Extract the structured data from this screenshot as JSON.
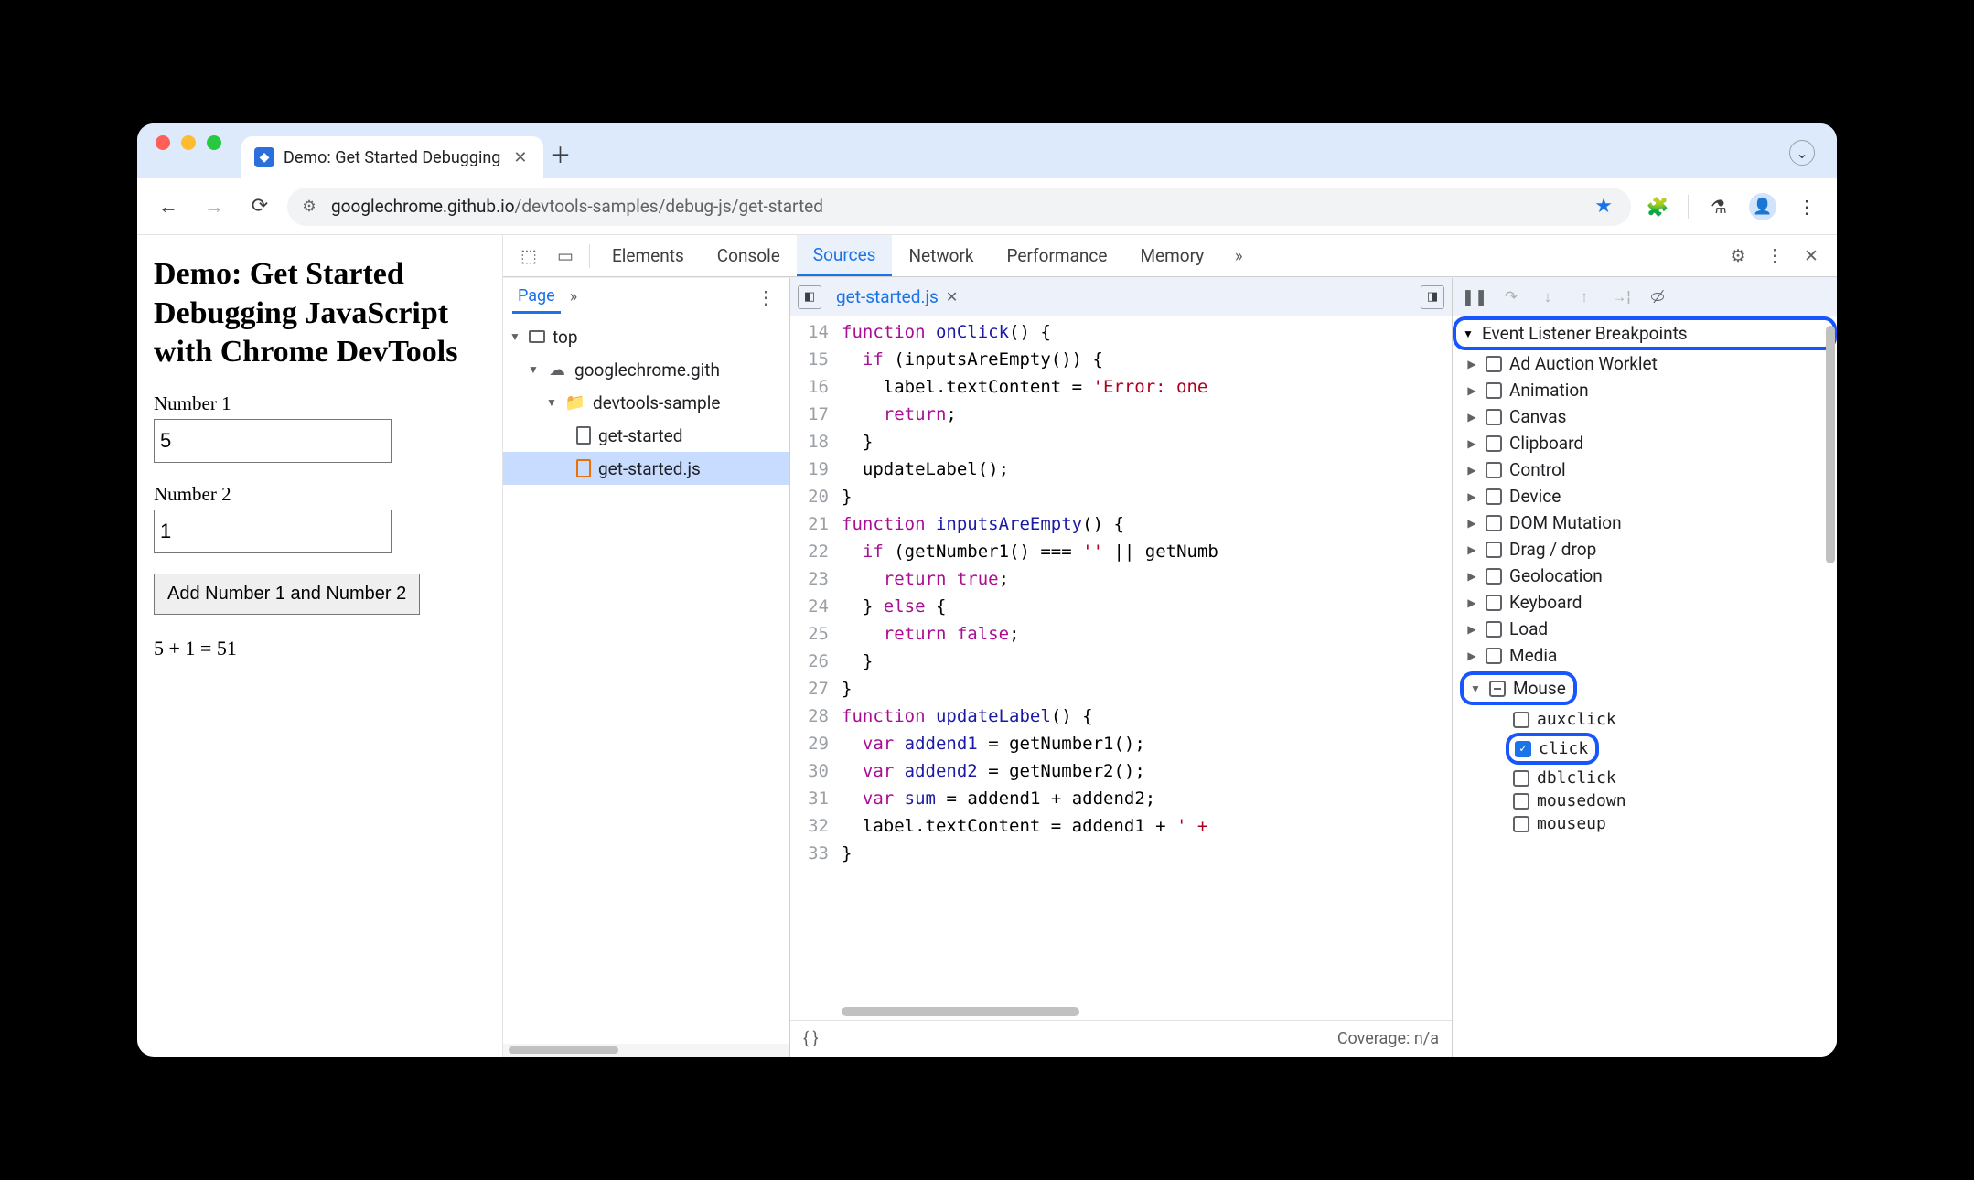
{
  "tab": {
    "title": "Demo: Get Started Debugging"
  },
  "url": {
    "host": "googlechrome.github.io",
    "path": "/devtools-samples/debug-js/get-started"
  },
  "page": {
    "heading": "Demo: Get Started Debugging JavaScript with Chrome DevTools",
    "label1": "Number 1",
    "value1": "5",
    "label2": "Number 2",
    "value2": "1",
    "button": "Add Number 1 and Number 2",
    "result": "5 + 1 = 51"
  },
  "devtools": {
    "tabs": [
      "Elements",
      "Console",
      "Sources",
      "Network",
      "Performance",
      "Memory"
    ],
    "active_tab": "Sources",
    "nav": {
      "page_tab": "Page",
      "tree": {
        "top": "top",
        "origin": "googlechrome.gith",
        "folder": "devtools-sample",
        "file_html": "get-started",
        "file_js": "get-started.js"
      }
    },
    "editor": {
      "file_tab": "get-started.js",
      "footer_left": "{ }",
      "footer_right": "Coverage: n/a",
      "lines": [
        {
          "n": 14,
          "h": "<span class='tok-kw'>function</span> <span class='tok-fn'>onClick</span>() {"
        },
        {
          "n": 15,
          "h": "  <span class='tok-kw'>if</span> (inputsAreEmpty()) {"
        },
        {
          "n": 16,
          "h": "    label.textContent = <span class='tok-str'>'Error: one</span>"
        },
        {
          "n": 17,
          "h": "    <span class='tok-kw'>return</span>;"
        },
        {
          "n": 18,
          "h": "  }"
        },
        {
          "n": 19,
          "h": "  updateLabel();"
        },
        {
          "n": 20,
          "h": "}"
        },
        {
          "n": 21,
          "h": "<span class='tok-kw'>function</span> <span class='tok-fn'>inputsAreEmpty</span>() {"
        },
        {
          "n": 22,
          "h": "  <span class='tok-kw'>if</span> (getNumber1() === <span class='tok-str'>''</span> || getNumb"
        },
        {
          "n": 23,
          "h": "    <span class='tok-kw'>return</span> <span class='tok-kw'>true</span>;"
        },
        {
          "n": 24,
          "h": "  } <span class='tok-kw'>else</span> {"
        },
        {
          "n": 25,
          "h": "    <span class='tok-kw'>return</span> <span class='tok-kw'>false</span>;"
        },
        {
          "n": 26,
          "h": "  }"
        },
        {
          "n": 27,
          "h": "}"
        },
        {
          "n": 28,
          "h": "<span class='tok-kw'>function</span> <span class='tok-fn'>updateLabel</span>() {"
        },
        {
          "n": 29,
          "h": "  <span class='tok-kw'>var</span> <span class='tok-fn'>addend1</span> = getNumber1();"
        },
        {
          "n": 30,
          "h": "  <span class='tok-kw'>var</span> <span class='tok-fn'>addend2</span> = getNumber2();"
        },
        {
          "n": 31,
          "h": "  <span class='tok-kw'>var</span> <span class='tok-fn'>sum</span> = addend1 + addend2;"
        },
        {
          "n": 32,
          "h": "  label.textContent = addend1 + <span class='tok-str'>' +</span>"
        },
        {
          "n": 33,
          "h": "}"
        }
      ]
    },
    "debugger": {
      "section": "Event Listener Breakpoints",
      "categories": [
        {
          "name": "Ad Auction Worklet",
          "expanded": false,
          "state": "off"
        },
        {
          "name": "Animation",
          "expanded": false,
          "state": "off"
        },
        {
          "name": "Canvas",
          "expanded": false,
          "state": "off"
        },
        {
          "name": "Clipboard",
          "expanded": false,
          "state": "off"
        },
        {
          "name": "Control",
          "expanded": false,
          "state": "off"
        },
        {
          "name": "Device",
          "expanded": false,
          "state": "off"
        },
        {
          "name": "DOM Mutation",
          "expanded": false,
          "state": "off"
        },
        {
          "name": "Drag / drop",
          "expanded": false,
          "state": "off"
        },
        {
          "name": "Geolocation",
          "expanded": false,
          "state": "off"
        },
        {
          "name": "Keyboard",
          "expanded": false,
          "state": "off"
        },
        {
          "name": "Load",
          "expanded": false,
          "state": "off"
        },
        {
          "name": "Media",
          "expanded": false,
          "state": "off"
        },
        {
          "name": "Mouse",
          "expanded": true,
          "state": "mixed",
          "highlight": true,
          "children": [
            {
              "name": "auxclick",
              "checked": false
            },
            {
              "name": "click",
              "checked": true,
              "highlight": true
            },
            {
              "name": "dblclick",
              "checked": false
            },
            {
              "name": "mousedown",
              "checked": false
            },
            {
              "name": "mouseup",
              "checked": false
            }
          ]
        }
      ]
    }
  }
}
